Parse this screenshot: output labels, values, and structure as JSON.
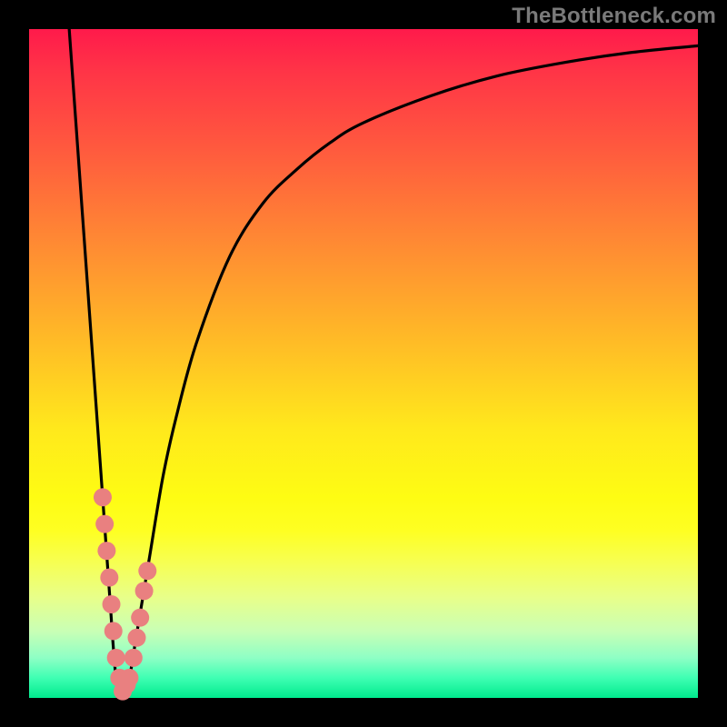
{
  "watermark": "TheBottleneck.com",
  "colors": {
    "frame": "#000000",
    "curve": "#000000",
    "marker_fill": "#e98080",
    "marker_stroke": "#cf5a5a",
    "gradient_top": "#ff1a4b",
    "gradient_bottom": "#00ea8d"
  },
  "chart_data": {
    "type": "line",
    "title": "",
    "xlabel": "",
    "ylabel": "",
    "xlim": [
      0,
      100
    ],
    "ylim": [
      0,
      100
    ],
    "grid": false,
    "legend": false,
    "series": [
      {
        "name": "bottleneck-curve",
        "x": [
          6,
          8,
          10,
          11,
          12,
          13,
          14,
          15,
          16,
          17,
          18,
          20,
          22,
          25,
          30,
          35,
          40,
          45,
          50,
          60,
          70,
          80,
          90,
          100
        ],
        "y": [
          100,
          72,
          44,
          30,
          16,
          3,
          0,
          3,
          9,
          15,
          21,
          33,
          42,
          53,
          66,
          74,
          79,
          83,
          86,
          90,
          93,
          95,
          96.5,
          97.5
        ]
      }
    ],
    "markers": [
      {
        "x": 11.0,
        "y": 30
      },
      {
        "x": 11.3,
        "y": 26
      },
      {
        "x": 11.6,
        "y": 22
      },
      {
        "x": 12.0,
        "y": 18
      },
      {
        "x": 12.3,
        "y": 14
      },
      {
        "x": 12.6,
        "y": 10
      },
      {
        "x": 13.0,
        "y": 6
      },
      {
        "x": 13.5,
        "y": 3
      },
      {
        "x": 14.0,
        "y": 1
      },
      {
        "x": 14.6,
        "y": 2
      },
      {
        "x": 15.0,
        "y": 3
      },
      {
        "x": 15.6,
        "y": 6
      },
      {
        "x": 16.1,
        "y": 9
      },
      {
        "x": 16.6,
        "y": 12
      },
      {
        "x": 17.2,
        "y": 16
      },
      {
        "x": 17.7,
        "y": 19
      }
    ],
    "annotations": []
  }
}
